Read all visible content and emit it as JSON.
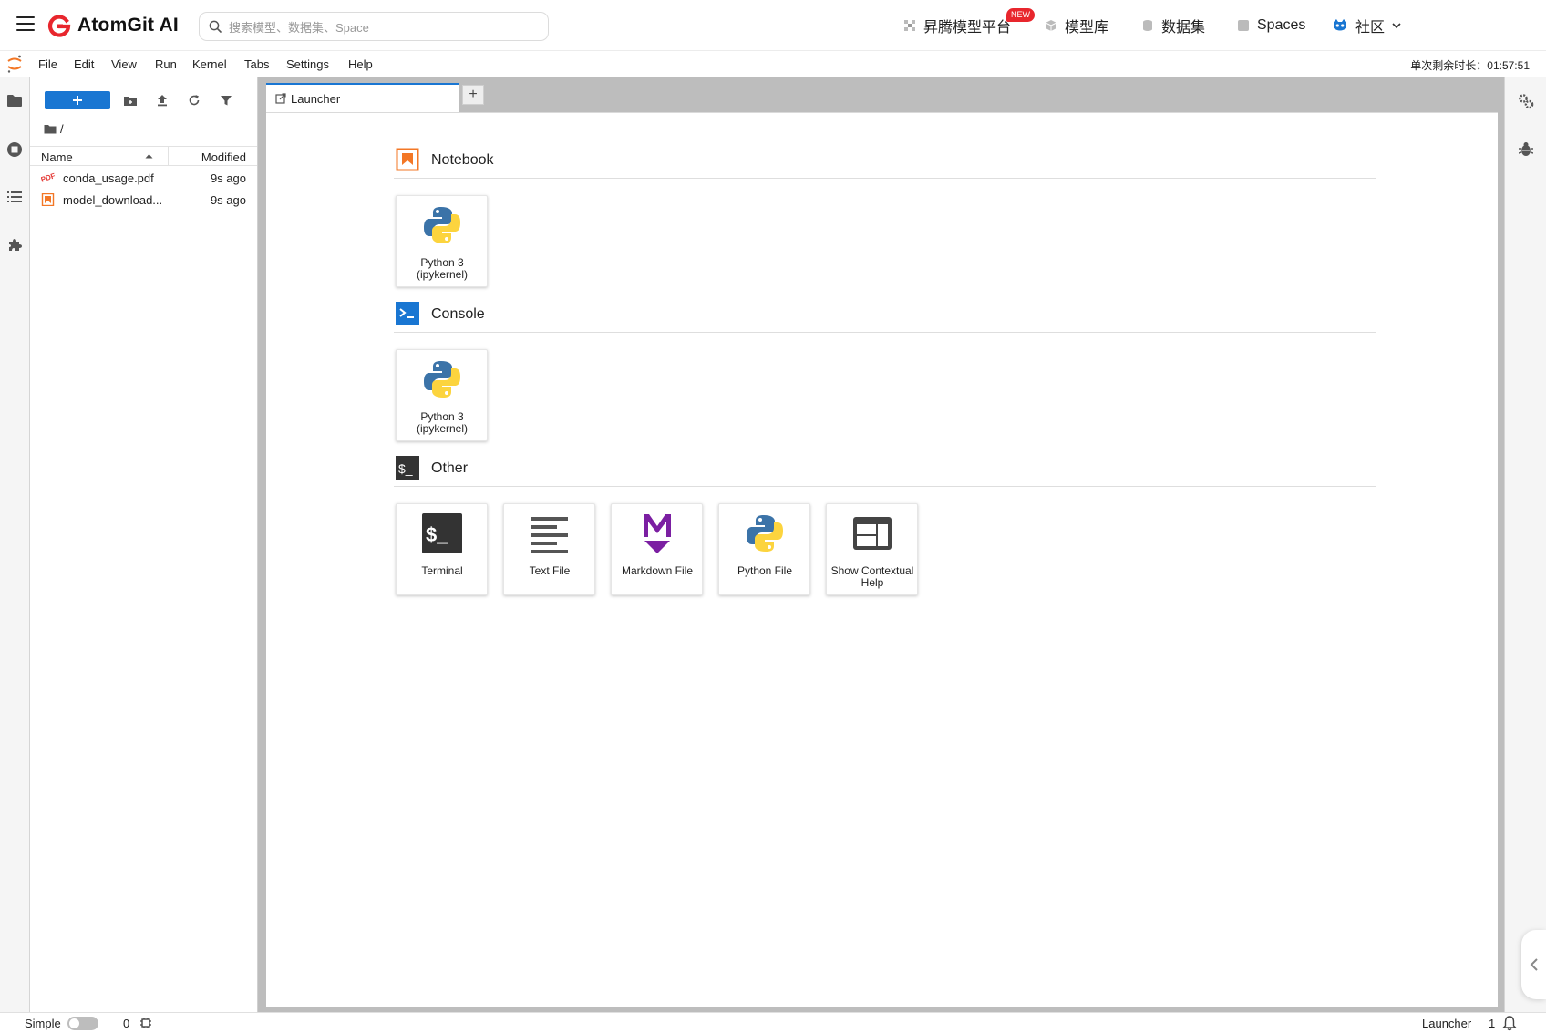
{
  "site": {
    "brand": "AtomGit AI",
    "search_placeholder": "搜索模型、数据集、Space",
    "nav": {
      "ascend_platform": "昇腾模型平台",
      "new_badge": "NEW",
      "model_library": "模型库",
      "datasets": "数据集",
      "spaces": "Spaces",
      "community": "社区"
    }
  },
  "menubar": {
    "items": [
      "File",
      "Edit",
      "View",
      "Run",
      "Kernel",
      "Tabs",
      "Settings",
      "Help"
    ],
    "session_time": "单次剩余时长：01:57:51"
  },
  "file_browser": {
    "breadcrumb": "/",
    "columns": {
      "name": "Name",
      "modified": "Modified"
    },
    "files": [
      {
        "name": "conda_usage.pdf",
        "modified": "9s ago",
        "icon": "pdf-icon"
      },
      {
        "name": "model_download...",
        "modified": "9s ago",
        "icon": "notebook-icon"
      }
    ]
  },
  "dock": {
    "tab_label": "Launcher",
    "add_tab": "+"
  },
  "launcher": {
    "sections": [
      {
        "title": "Notebook",
        "icon": "notebook-section-icon",
        "color": "#f37726",
        "cards": [
          {
            "label": "Python 3 (ipykernel)",
            "icon": "python-icon"
          }
        ]
      },
      {
        "title": "Console",
        "icon": "console-section-icon",
        "color": "#1976d2",
        "cards": [
          {
            "label": "Python 3 (ipykernel)",
            "icon": "python-icon"
          }
        ]
      },
      {
        "title": "Other",
        "icon": "terminal-section-icon",
        "color": "#333333",
        "cards": [
          {
            "label": "Terminal",
            "icon": "terminal-icon"
          },
          {
            "label": "Text File",
            "icon": "text-file-icon"
          },
          {
            "label": "Markdown File",
            "icon": "markdown-icon"
          },
          {
            "label": "Python File",
            "icon": "python-icon"
          },
          {
            "label": "Show Contextual Help",
            "icon": "contextual-help-icon"
          }
        ]
      }
    ]
  },
  "status_bar": {
    "mode_label": "Simple",
    "kernel_count": "0",
    "active_tab": "Launcher",
    "notification_count": "1"
  },
  "colors": {
    "accent": "#1976d2",
    "brand_red": "#e8262d",
    "jupyter_orange": "#f37726",
    "markdown_purple": "#7b1fa2"
  }
}
